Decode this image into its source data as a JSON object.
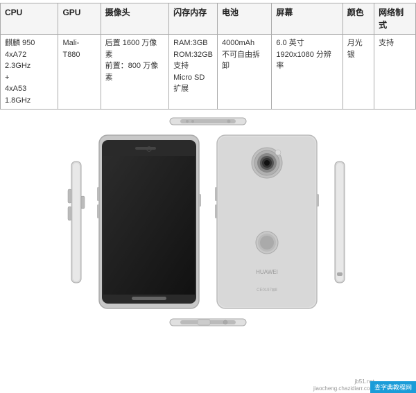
{
  "table": {
    "headers": [
      "CPU",
      "GPU",
      "摄像头",
      "闪存内存",
      "电池",
      "屏幕",
      "颜色",
      "网络制式"
    ],
    "row": {
      "cpu": "麒麟 950\n4xA72 2.3GHz\n+\n4xA53 1.8GHz",
      "gpu": "Mali-T880",
      "camera": "后置 1600 万像素\n前置：800 万像素",
      "memory": "RAM:3GB\nROM:32GB\n支持\nMicro SD\n扩展",
      "battery": "4000mAh\n不可自由拆卸",
      "screen": "6.0 英寸\n1920x1080 分辨率",
      "color": "月光银",
      "network": "支持"
    }
  },
  "watermark": {
    "site1": "jb51.net",
    "site2": "jiaocheng.chazidia rr.com",
    "blue_label": "查字典教程网"
  }
}
